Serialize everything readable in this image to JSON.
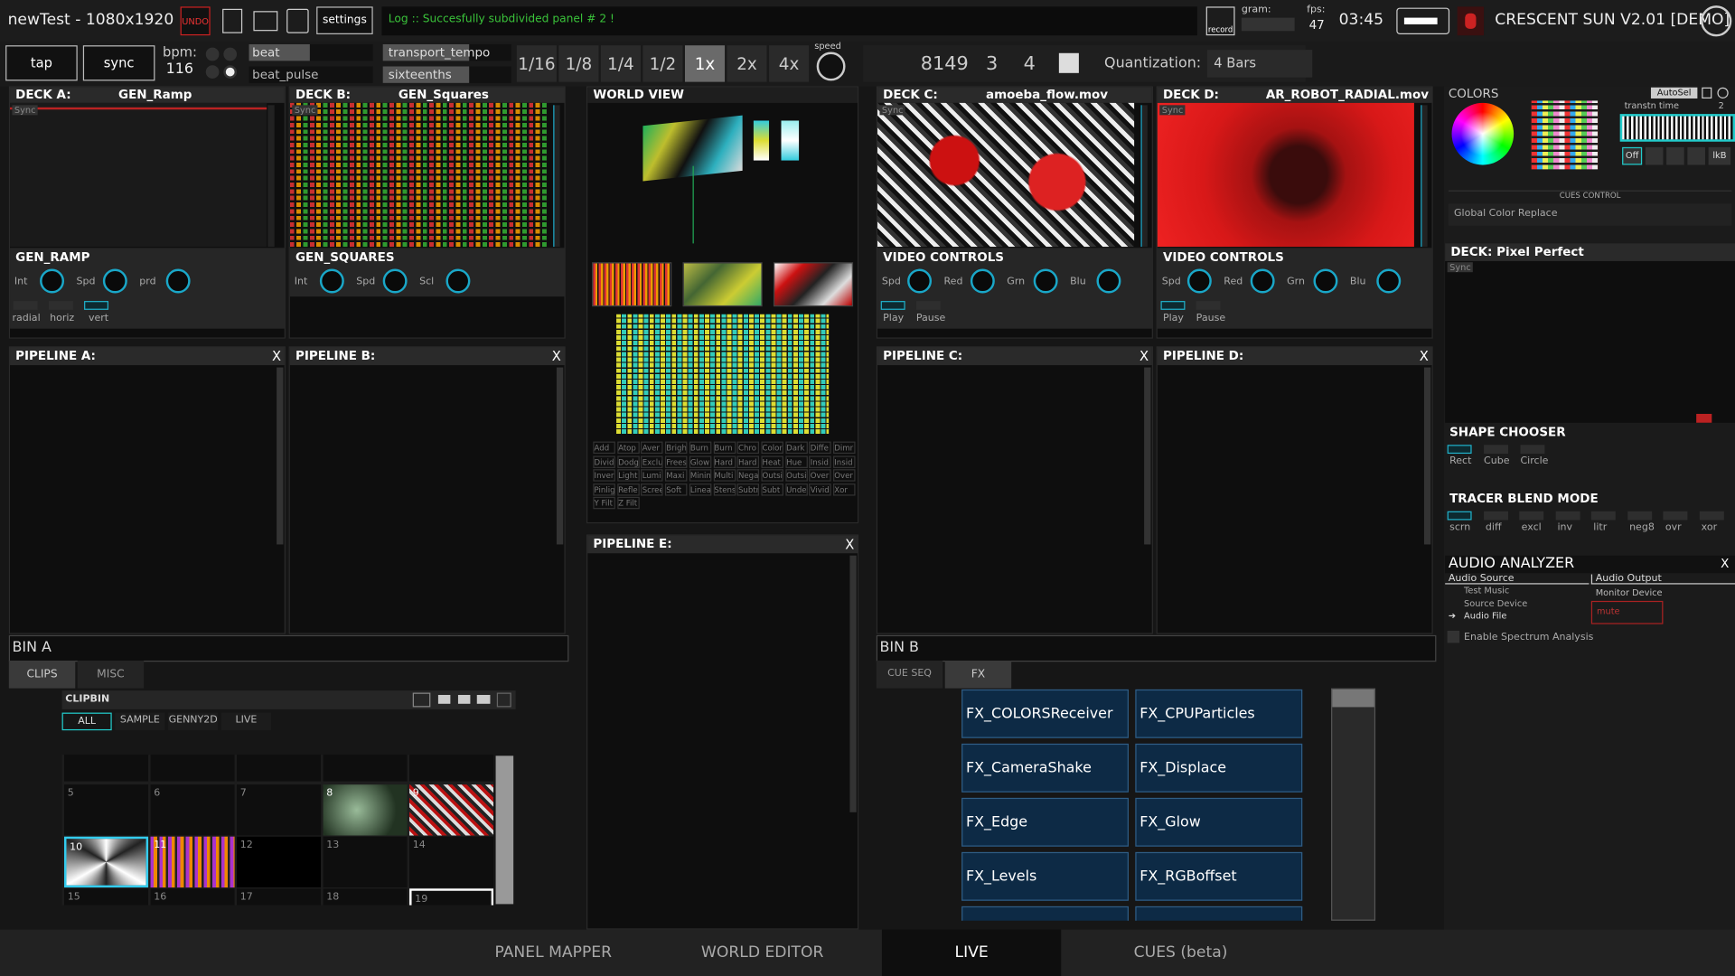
{
  "topbar": {
    "title": "newTest - 1080x1920",
    "undo": "UNDO",
    "settings": "settings",
    "log": "Log :: Succesfully subdivided panel # 2 !",
    "record": "record",
    "gram": "gram:",
    "fps_label": "fps:",
    "fps": "47",
    "time": "03:45",
    "app": "CRESCENT SUN V2.01 [DEMO]"
  },
  "transport": {
    "tap": "tap",
    "sync": "sync",
    "bpm_label": "bpm:",
    "bpm": "116",
    "beat": "beat",
    "beat_pulse": "beat_pulse",
    "transport_tempo": "transport_tempo",
    "sixteenths": "sixteenths",
    "rates": [
      "1/16",
      "1/8",
      "1/4",
      "1/2",
      "1x",
      "2x",
      "4x"
    ],
    "speed": "speed",
    "counter": "8149",
    "n1": "3",
    "n2": "4",
    "quant_label": "Quantization:",
    "quant": "4 Bars"
  },
  "decks": {
    "a": {
      "label": "DECK A:",
      "name": "GEN_Ramp",
      "ctrl": "GEN_RAMP",
      "knobs": [
        "Int",
        "Spd",
        "prd"
      ],
      "toggles": [
        "radial",
        "horiz",
        "vert"
      ],
      "sync": "Sync"
    },
    "b": {
      "label": "DECK B:",
      "name": "GEN_Squares",
      "ctrl": "GEN_SQUARES",
      "knobs": [
        "Int",
        "Spd",
        "Scl"
      ],
      "sync": "Sync"
    },
    "c": {
      "label": "DECK C:",
      "name": "amoeba_flow.mov",
      "ctrl": "VIDEO CONTROLS",
      "knobs": [
        "Spd",
        "Red",
        "Grn",
        "Blu"
      ],
      "toggles": [
        "Play",
        "Pause"
      ],
      "sync": "Sync"
    },
    "d": {
      "label": "DECK D:",
      "name": "AR_ROBOT_RADIAL.mov",
      "ctrl": "VIDEO CONTROLS",
      "knobs": [
        "Spd",
        "Red",
        "Grn",
        "Blu"
      ],
      "toggles": [
        "Play",
        "Pause"
      ],
      "sync": "Sync"
    }
  },
  "world": {
    "title": "WORLD VIEW",
    "blend_modes": [
      "Add",
      "Atop",
      "Aver",
      "Brigh",
      "Burn",
      "Burn",
      "Chro",
      "Color",
      "Dark",
      "Diffe",
      "Dimr",
      "Divid",
      "Dodg",
      "Exclu",
      "Frees",
      "Glow",
      "Hard",
      "Hard",
      "Heat",
      "Hue",
      "Insid",
      "Insid",
      "Inver",
      "Light",
      "Lumi",
      "Maxi",
      "Minin",
      "Multi",
      "Nega",
      "Outsi",
      "Outsi",
      "Over",
      "Over",
      "Pinlig",
      "Refle",
      "Scree",
      "Soft",
      "Linea",
      "Stens",
      "Subtr",
      "Subt",
      "Unde",
      "Vivid",
      "Xor",
      "Y Filt",
      "Z Filt"
    ]
  },
  "pipelines": {
    "a": "PIPELINE A:",
    "b": "PIPELINE B:",
    "c": "PIPELINE C:",
    "d": "PIPELINE D:",
    "e": "PIPELINE E:",
    "close": "X"
  },
  "binA": {
    "title": "BIN A",
    "tabs": [
      "CLIPS",
      "MISC"
    ],
    "clipbin": "CLIPBIN",
    "filters": [
      "ALL",
      "SAMPLE",
      "GENNY2D",
      "LIVE"
    ],
    "cells": [
      "5",
      "6",
      "7",
      "8",
      "9",
      "10",
      "11",
      "12",
      "13",
      "14",
      "15",
      "16",
      "17",
      "18",
      "19"
    ]
  },
  "binB": {
    "title": "BIN B",
    "tabs": [
      "CUE SEQ",
      "FX"
    ],
    "fx": [
      "FX_COLORSReceiver",
      "FX_CPUParticles",
      "FX_CameraShake",
      "FX_Displace",
      "FX_Edge",
      "FX_Glow",
      "FX_Levels",
      "FX_RGBoffset"
    ]
  },
  "side": {
    "colors": "COLORS",
    "autosel": "AutoSel",
    "transtn": "transtn time",
    "transtn_val": "2",
    "off": "Off",
    "lkb": "lkB",
    "cues_control": "CUES CONTROL",
    "global_color": "Global Color Replace",
    "deck_pp": "DECK: Pixel Perfect",
    "sync": "Sync",
    "shape_title": "SHAPE CHOOSER",
    "shapes": [
      "Rect",
      "Cube",
      "Circle"
    ],
    "tracer_title": "TRACER BLEND MODE",
    "tracer": [
      "scrn",
      "diff",
      "excl",
      "inv",
      "litr",
      "neg8",
      "ovr",
      "xor"
    ],
    "audio_title": "AUDIO ANALYZER",
    "audio_close": "X",
    "audio_source": "Audio Source",
    "audio_output": "Audio Output",
    "sources": [
      "Test Music",
      "Source Device",
      "Audio File"
    ],
    "monitor": "Monitor Device",
    "mute": "mute",
    "spectrum": "Enable Spectrum Analysis"
  },
  "bottom": {
    "tabs": [
      "PANEL MAPPER",
      "WORLD EDITOR",
      "LIVE",
      "CUES (beta)"
    ]
  }
}
